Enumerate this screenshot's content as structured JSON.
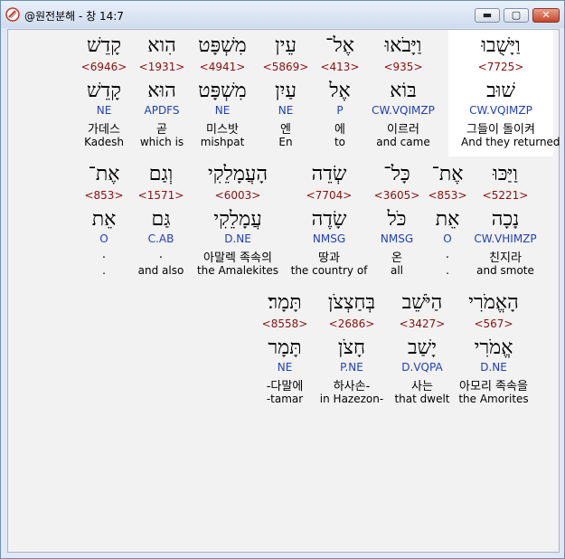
{
  "window": {
    "title": "@원전분해 - 창 14:7",
    "controls": {
      "minimize": "▬",
      "maximize": "▢",
      "close": "✕"
    }
  },
  "rows": [
    {
      "words": [
        {
          "hebrew": "וַיָּשֻׁבוּ",
          "strong": "<7725>",
          "lemma": "שׁוּב",
          "parse": "CW.VQIMZP",
          "korean": "그들이 돌이켜",
          "english": "And they returned",
          "highlighted": true
        },
        {
          "hebrew": "וַיָּבֹאוּ",
          "strong": "<935>",
          "lemma": "בּוֹא",
          "parse": "CW.VQIMZP",
          "korean": "이르러",
          "english": "and came"
        },
        {
          "hebrew": "אֶל־",
          "strong": "<413>",
          "lemma": "אֶל",
          "parse": "P",
          "korean": "에",
          "english": "to"
        },
        {
          "hebrew": "עֵין",
          "strong": "<5869>",
          "lemma": "עַיִן",
          "parse": "NE",
          "korean": "엔",
          "english": "En"
        },
        {
          "hebrew": "מִשְׁפָּט",
          "strong": "<4941>",
          "lemma": "מִשְׁפָּט",
          "parse": "NE",
          "korean": "미스밧",
          "english": "mishpat"
        },
        {
          "hebrew": "הִוא",
          "strong": "<1931>",
          "lemma": "הוּא",
          "parse": "APDFS",
          "korean": "곧",
          "english": "which is"
        },
        {
          "hebrew": "קָדֵשׁ",
          "strong": "<6946>",
          "lemma": "קָדֵשׁ",
          "parse": "NE",
          "korean": "가데스",
          "english": "Kadesh"
        }
      ]
    },
    {
      "words": [
        {
          "hebrew": "וַיַּכּוּ",
          "strong": "<5221>",
          "lemma": "נָכָה",
          "parse": "CW.VHIMZP",
          "korean": "친지라",
          "english": "and smote"
        },
        {
          "hebrew": "אֶת־",
          "strong": "<853>",
          "lemma": "אֵת",
          "parse": "O",
          "korean": ".",
          "english": "."
        },
        {
          "hebrew": "כָּל־",
          "strong": "<3605>",
          "lemma": "כֹּל",
          "parse": "NMSG",
          "korean": "온",
          "english": "all"
        },
        {
          "hebrew": "שְׂדֵה",
          "strong": "<7704>",
          "lemma": "שָׂדֶה",
          "parse": "NMSG",
          "korean": "땅과",
          "english": "the country of"
        },
        {
          "hebrew": "הָעֲמָלֵקִי",
          "strong": "<6003>",
          "lemma": "עֲמָלֵקִי",
          "parse": "D.NE",
          "korean": "아말렉 족속의",
          "english": "the Amalekites"
        },
        {
          "hebrew": "וְגַם",
          "strong": "<1571>",
          "lemma": "גַּם",
          "parse": "C.AB",
          "korean": ".",
          "english": "and also"
        },
        {
          "hebrew": "אֶת־",
          "strong": "<853>",
          "lemma": "אֵת",
          "parse": "O",
          "korean": ".",
          "english": "."
        }
      ]
    },
    {
      "words": [
        {
          "hebrew": "הָאֱמֹרִי",
          "strong": "<567>",
          "lemma": "אֱמֹרִי",
          "parse": "D.NE",
          "korean": "아모리 족속을",
          "english": "the Amorites"
        },
        {
          "hebrew": "הַיֹּשֵׁב",
          "strong": "<3427>",
          "lemma": "יָשַׁב",
          "parse": "D.VQPA",
          "korean": "사는",
          "english": "that dwelt"
        },
        {
          "hebrew": "בְּחַצְצֹן",
          "strong": "<2686>",
          "lemma": "חָצֹן",
          "parse": "P.NE",
          "korean": "하사손-",
          "english": "in Hazezon-"
        },
        {
          "hebrew": "תָּמָר׃",
          "strong": "<8558>",
          "lemma": "תָּמָר",
          "parse": "NE",
          "korean": "-다말에",
          "english": "-tamar"
        }
      ]
    }
  ]
}
